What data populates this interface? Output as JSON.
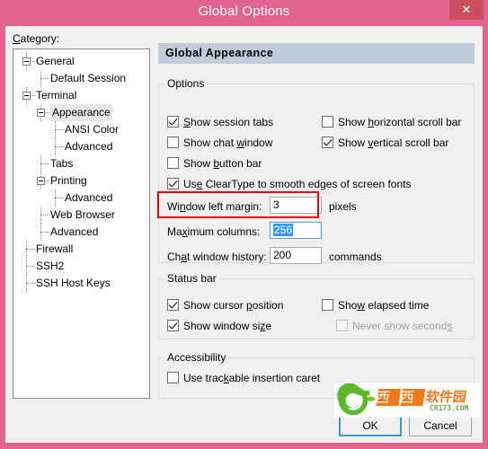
{
  "window": {
    "title": "Global Options",
    "close_label": "✕",
    "accent_title_bg": "#e0648f",
    "close_bg": "#c94f5f"
  },
  "category": {
    "label": "Category:",
    "tree": [
      {
        "label": "General",
        "indent": 0,
        "expander": true,
        "selected": false
      },
      {
        "label": "Default Session",
        "indent": 1,
        "expander": false,
        "selected": false
      },
      {
        "label": "Terminal",
        "indent": 0,
        "expander": true,
        "selected": false
      },
      {
        "label": "Appearance",
        "indent": 1,
        "expander": true,
        "selected": true
      },
      {
        "label": "ANSI Color",
        "indent": 2,
        "expander": false,
        "selected": false
      },
      {
        "label": "Advanced",
        "indent": 2,
        "expander": false,
        "selected": false
      },
      {
        "label": "Tabs",
        "indent": 1,
        "expander": false,
        "selected": false
      },
      {
        "label": "Printing",
        "indent": 1,
        "expander": true,
        "selected": false
      },
      {
        "label": "Advanced",
        "indent": 2,
        "expander": false,
        "selected": false
      },
      {
        "label": "Web Browser",
        "indent": 1,
        "expander": false,
        "selected": false
      },
      {
        "label": "Advanced",
        "indent": 1,
        "expander": false,
        "selected": false
      },
      {
        "label": "Firewall",
        "indent": 0,
        "expander": false,
        "selected": false
      },
      {
        "label": "SSH2",
        "indent": 0,
        "expander": false,
        "selected": false
      },
      {
        "label": "SSH Host Keys",
        "indent": 0,
        "expander": false,
        "selected": false
      }
    ]
  },
  "panel": {
    "header": "Global Appearance",
    "header_bg": "#c0ccda"
  },
  "options_group": {
    "title": "Options",
    "checkboxes": [
      {
        "label": "Show session tabs",
        "checked": true,
        "enabled": true
      },
      {
        "label": "Show horizontal scroll bar",
        "checked": false,
        "enabled": true
      },
      {
        "label": "Show chat window",
        "checked": false,
        "enabled": true
      },
      {
        "label": "Show vertical scroll bar",
        "checked": true,
        "enabled": true
      },
      {
        "label": "Show button bar",
        "checked": false,
        "enabled": true
      },
      {
        "label": "Use ClearType to smooth edges of screen fonts",
        "checked": true,
        "enabled": true
      }
    ],
    "fields": [
      {
        "label": "Window left margin:",
        "value": "3",
        "suffix": "pixels",
        "focused": false
      },
      {
        "label": "Maximum columns:",
        "value": "256",
        "suffix": "",
        "focused": true
      },
      {
        "label": "Chat window history:",
        "value": "200",
        "suffix": "commands",
        "focused": false
      }
    ]
  },
  "status_group": {
    "title": "Status bar",
    "checkboxes": [
      {
        "label": "Show cursor position",
        "checked": true,
        "enabled": true
      },
      {
        "label": "Show elapsed time",
        "checked": false,
        "enabled": true
      },
      {
        "label": "Show window size",
        "checked": true,
        "enabled": true
      },
      {
        "label": "Never show seconds",
        "checked": false,
        "enabled": false
      }
    ]
  },
  "accessibility_group": {
    "title": "Accessibility",
    "checkboxes": [
      {
        "label": "Use trackable insertion caret",
        "checked": false,
        "enabled": true
      }
    ]
  },
  "buttons": {
    "ok": "OK",
    "cancel": "Cancel"
  },
  "watermark": {
    "brand_cn": "西西",
    "brand_cn2": "软件园",
    "url": "CR173.COM",
    "logo_color": "#5cb82e",
    "orange": "#f07a1a"
  },
  "annotation": {
    "color": "#ee0000",
    "targets": "Maximum columns field"
  }
}
